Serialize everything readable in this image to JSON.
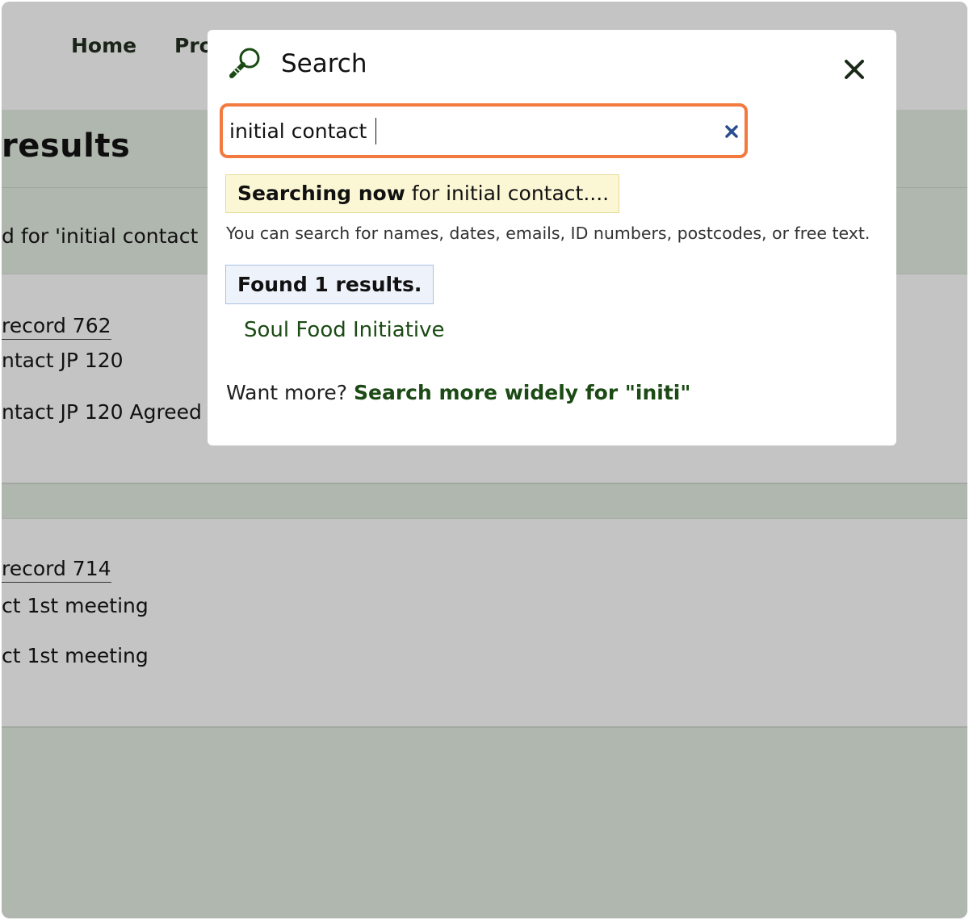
{
  "background": {
    "nav": {
      "home": "Home",
      "second_partial": "Pro"
    },
    "results_title_partial": "results",
    "subtitle_partial": "d for 'initial contact",
    "cards": [
      {
        "record_link_partial": "record 762",
        "line1_partial": "ntact JP 120",
        "line2_partial": "ntact JP 120 Agreed"
      },
      {
        "record_link_partial": "record 714",
        "line1_partial": "ct 1st meeting",
        "line2_partial": "ct 1st meeting"
      }
    ]
  },
  "modal": {
    "title": "Search",
    "icon": "magnifier-icon",
    "close_icon": "close-icon",
    "input": {
      "value": "initial contact",
      "clear_icon": "clear-icon"
    },
    "status": {
      "bold": "Searching now",
      "rest": " for initial contact...."
    },
    "help": "You can search for names, dates, emails, ID numbers, postcodes, or free text.",
    "found": "Found 1 results.",
    "results": [
      "Soul Food Initiative"
    ],
    "more": {
      "prefix": "Want more? ",
      "link": "Search more widely for \"initi\""
    }
  },
  "colors": {
    "input_focus_border": "#f27a3f",
    "link_green": "#1b4a14",
    "status_bg": "#fbf6d4",
    "found_bg": "#eef3fb",
    "overlay": "#b0b7ae",
    "clear_icon": "#2a4f8f"
  }
}
